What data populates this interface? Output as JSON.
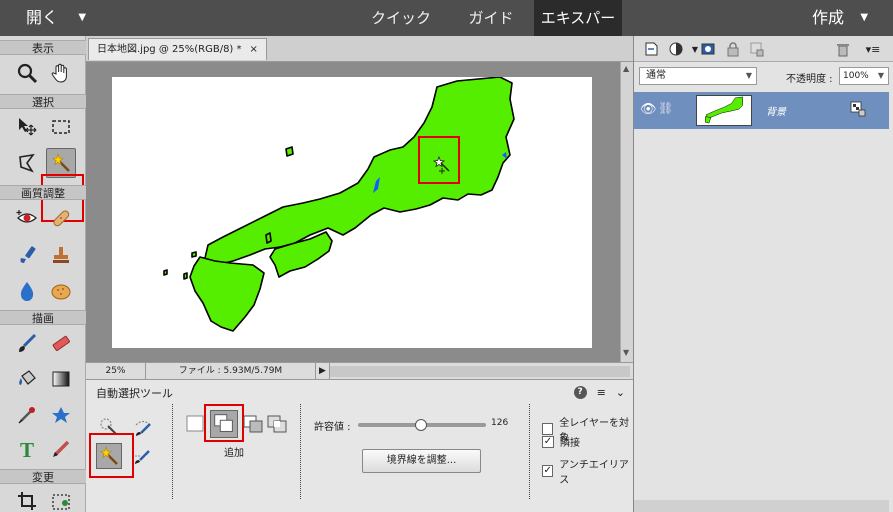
{
  "topbar": {
    "open_label": "開く",
    "modes": [
      "クイック",
      "ガイド",
      "エキスパート"
    ],
    "active_mode": "エキスパート",
    "create_label": "作成"
  },
  "toolbox": {
    "sections": [
      "表示",
      "選択",
      "画質調整",
      "描画",
      "変更"
    ],
    "active_tool": "magic-wand-tool"
  },
  "document": {
    "tab_title": "日本地図.jpg @ 25%(RGB/8) *",
    "tab_close": "×",
    "map_fill_color": "#55ee00"
  },
  "status": {
    "zoom": "25%",
    "file_info": "ファイル : 5.93M/5.79M",
    "arrow": "▶"
  },
  "tool_options": {
    "title": "自動選択ツール",
    "mode_caption": "追加",
    "tolerance_label": "許容値 :",
    "tolerance_value": "126",
    "tolerance_max": 255,
    "refine_label": "境界線を調整...",
    "checkboxes": [
      {
        "label": "全レイヤーを対象",
        "checked": false
      },
      {
        "label": "隣接",
        "checked": true
      },
      {
        "label": "アンチエイリアス",
        "checked": true
      }
    ],
    "help_icon": "?",
    "menu_icon": "≡",
    "collapse_icon": "⌄"
  },
  "layers": {
    "blend_mode": "通常",
    "opacity_label": "不透明度 :",
    "opacity_value": "100%",
    "layer_name": "背景"
  },
  "colors": {
    "highlight": "#e00000",
    "layer_selected": "#6f8fbf",
    "map_outline": "#000000",
    "water_blue": "#1060ff"
  }
}
